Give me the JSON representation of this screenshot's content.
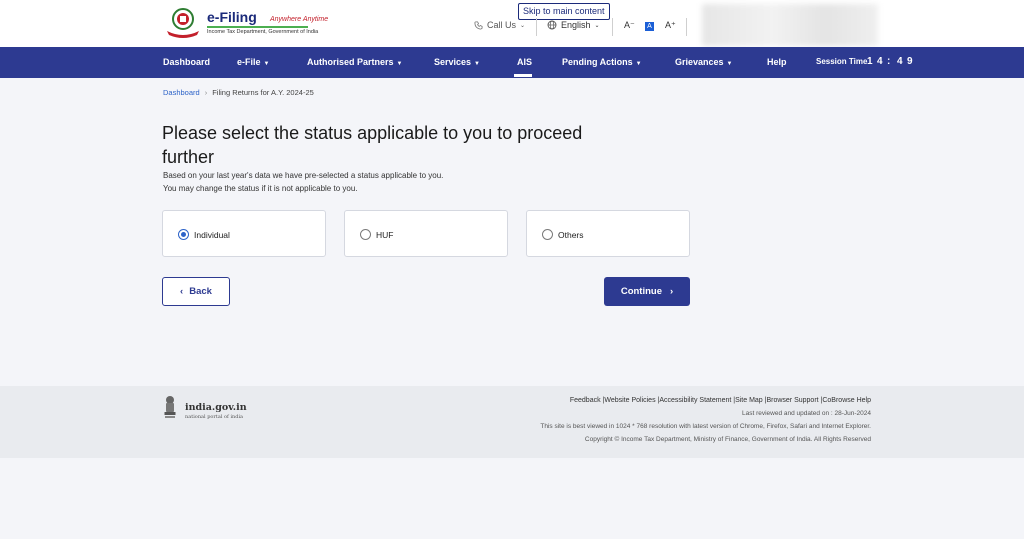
{
  "header": {
    "brand": "e-Filing",
    "tagline": "Anywhere Anytime",
    "subtitle": "Income Tax Department, Government of India",
    "skip_link": "Skip to main content",
    "call_us": "Call Us",
    "language": "English",
    "font_decrease": "A⁻",
    "font_normal": "A",
    "font_increase": "A⁺"
  },
  "nav": {
    "items": [
      "Dashboard",
      "e-File",
      "Authorised Partners",
      "Services",
      "AIS",
      "Pending Actions",
      "Grievances",
      "Help"
    ],
    "session_label": "Session Time",
    "session_digits": [
      "1",
      "4",
      ":",
      "4",
      "9"
    ]
  },
  "breadcrumb": {
    "home": "Dashboard",
    "current": "Filing Returns for A.Y. 2024-25"
  },
  "main": {
    "title": "Please select the status applicable to you to proceed further",
    "desc_line1": "Based on your last year's data we have pre-selected a status applicable to you.",
    "desc_line2": "You may change the status if it is not applicable to you.",
    "options": [
      {
        "label": "Individual",
        "selected": true
      },
      {
        "label": "HUF",
        "selected": false
      },
      {
        "label": "Others",
        "selected": false
      }
    ],
    "back_label": "Back",
    "continue_label": "Continue"
  },
  "footer": {
    "portal_name": "india.gov.in",
    "portal_sub": "national portal of india",
    "links": "Feedback |Website Policies |Accessibility Statement |Site Map |Browser Support |CoBrowse Help",
    "updated": "Last reviewed and updated on : 28-Jun-2024",
    "best_viewed": "This site is best viewed in 1024 * 768 resolution with latest version of Chrome, Firefox, Safari and Internet Explorer.",
    "copyright": "Copyright © Income Tax Department, Ministry of Finance, Government of India. All Rights Reserved"
  },
  "colors": {
    "nav": "#2d3a91",
    "accent": "#2d63c8",
    "background": "#f4f5f9"
  }
}
